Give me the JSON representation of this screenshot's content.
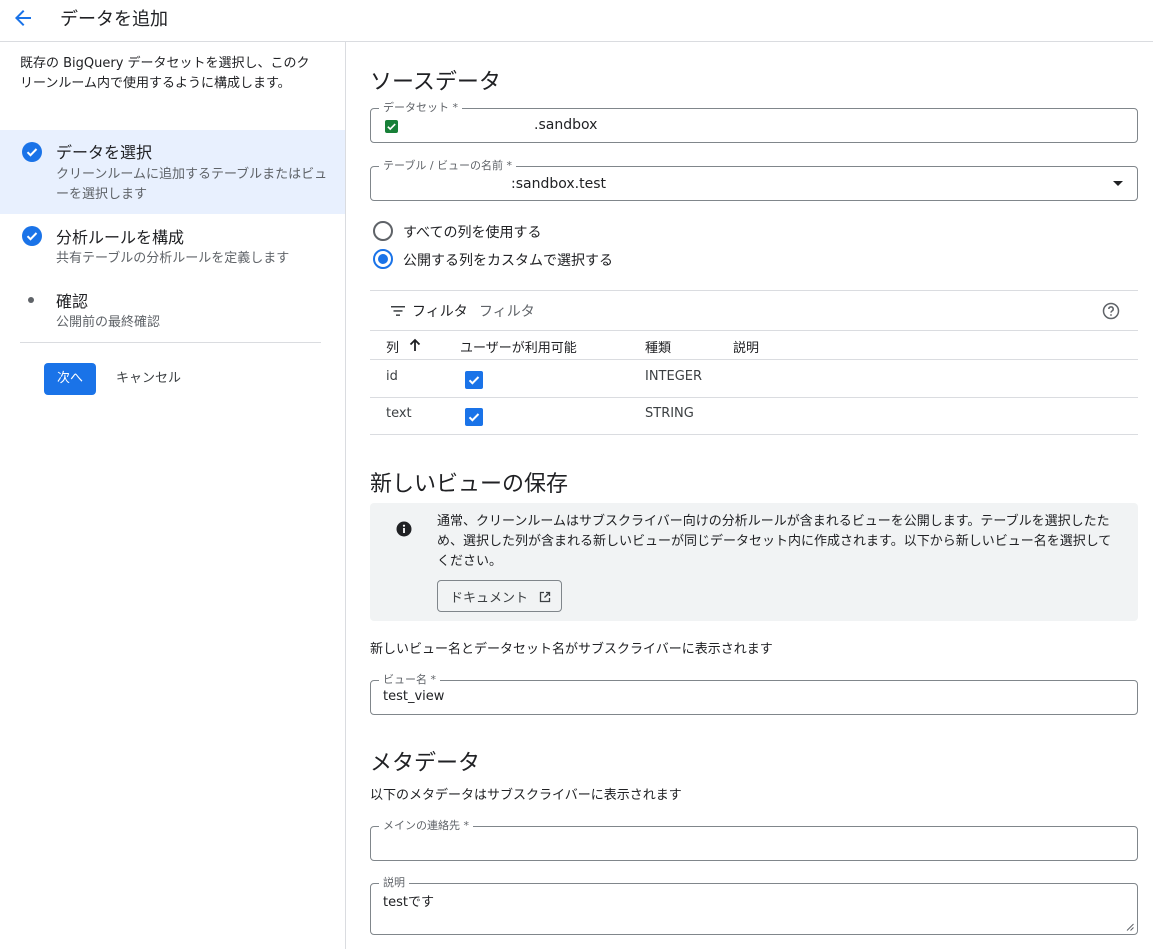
{
  "header": {
    "title": "データを追加"
  },
  "left_panel": {
    "intro": "既存の BigQuery データセットを選択し、このクリーンルーム内で使用するように構成します。",
    "steps": [
      {
        "title": "データを選択",
        "desc": "クリーンルームに追加するテーブルまたはビューを選択します",
        "state": "complete"
      },
      {
        "title": "分析ルールを構成",
        "desc": "共有テーブルの分析ルールを定義します",
        "state": "complete"
      },
      {
        "title": "確認",
        "desc": "公開前の最終確認",
        "state": "pending"
      }
    ],
    "next_label": "次へ",
    "cancel_label": "キャンセル"
  },
  "source": {
    "title": "ソースデータ",
    "dataset_label": "データセット *",
    "dataset_value": ".sandbox",
    "table_label": "テーブル / ビューの名前 *",
    "table_value": ":sandbox.test",
    "radio_all": "すべての列を使用する",
    "radio_custom": "公開する列をカスタムで選択する",
    "selected_radio": "custom"
  },
  "table": {
    "filter_label": "フィルタ",
    "filter_placeholder": "フィルタ",
    "headers": [
      "列",
      "ユーザーが利用可能",
      "種類",
      "説明"
    ],
    "rows": [
      {
        "name": "id",
        "available": true,
        "type": "INTEGER",
        "desc": ""
      },
      {
        "name": "text",
        "available": true,
        "type": "STRING",
        "desc": ""
      }
    ]
  },
  "new_view": {
    "title": "新しいビューの保存",
    "info": "通常、クリーンルームはサブスクライバー向けの分析ルールが含まれるビューを公開します。テーブルを選択したため、選択した列が含まれる新しいビューが同じデータセット内に作成されます。以下から新しいビュー名を選択してください。",
    "doc_button": "ドキュメント",
    "note": "新しいビュー名とデータセット名がサブスクライバーに表示されます",
    "view_name_label": "ビュー名 *",
    "view_name_value": "test_view"
  },
  "metadata": {
    "title": "メタデータ",
    "note": "以下のメタデータはサブスクライバーに表示されます",
    "contact_label": "メインの連絡先 *",
    "contact_value": "",
    "desc_label": "説明",
    "desc_value": "testです"
  },
  "colors": {
    "accent": "#1a73e8",
    "success": "#188038",
    "active_bg": "#e8f0fe"
  }
}
